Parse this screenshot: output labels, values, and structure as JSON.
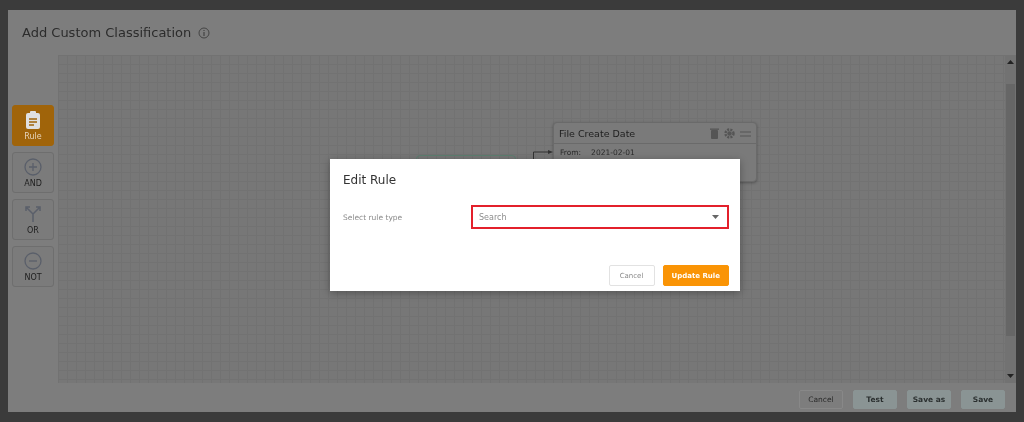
{
  "page_title": "Add Custom Classification",
  "toolbox": [
    {
      "kind": "rule",
      "label": "Rule",
      "selected": true
    },
    {
      "kind": "and",
      "label": "AND",
      "selected": false
    },
    {
      "kind": "or",
      "label": "OR",
      "selected": false
    },
    {
      "kind": "not",
      "label": "NOT",
      "selected": false
    }
  ],
  "canvas": {
    "nodes": [
      {
        "title": "File Create Date",
        "field_label": "From:",
        "field_value": "2021-02-01"
      }
    ]
  },
  "footer_buttons": [
    {
      "label": "Cancel",
      "kind": "secondary"
    },
    {
      "label": "Test",
      "kind": "primary"
    },
    {
      "label": "Save as",
      "kind": "primary"
    },
    {
      "label": "Save",
      "kind": "primary"
    }
  ],
  "modal": {
    "title": "Edit Rule",
    "field_label": "Select rule type",
    "placeholder": "Search",
    "highlighted": true,
    "buttons": [
      {
        "label": "Cancel",
        "kind": "secondary"
      },
      {
        "label": "Update Rule",
        "kind": "primary"
      }
    ]
  }
}
